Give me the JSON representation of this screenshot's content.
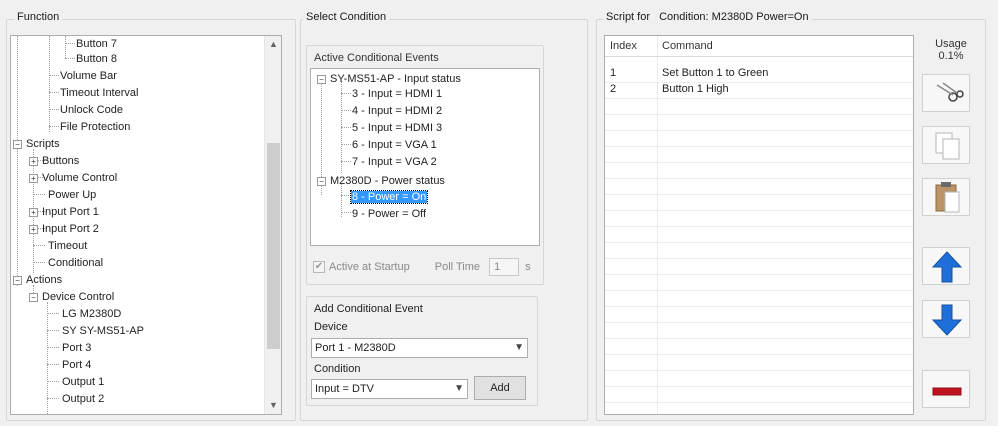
{
  "function_panel": {
    "title": "Function",
    "tree": [
      {
        "label": "Button 7"
      },
      {
        "label": "Button 8"
      },
      {
        "label": "Volume Bar"
      },
      {
        "label": "Timeout Interval"
      },
      {
        "label": "Unlock Code"
      },
      {
        "label": "File Protection"
      },
      {
        "label": "Scripts"
      },
      {
        "label": "Buttons"
      },
      {
        "label": "Volume Control"
      },
      {
        "label": "Power Up"
      },
      {
        "label": "Input Port 1"
      },
      {
        "label": "Input Port 2"
      },
      {
        "label": "Timeout"
      },
      {
        "label": "Conditional"
      },
      {
        "label": "Actions"
      },
      {
        "label": "Device Control"
      },
      {
        "label": "LG M2380D"
      },
      {
        "label": "SY SY-MS51-AP"
      },
      {
        "label": "Port 3"
      },
      {
        "label": "Port 4"
      },
      {
        "label": "Output 1"
      },
      {
        "label": "Output 2"
      }
    ],
    "expanders": {
      "expanded": "−",
      "collapsed": "+"
    }
  },
  "condition_panel": {
    "title": "Select Condition",
    "active_events": {
      "title": "Active Conditional Events",
      "tree": [
        {
          "label": "SY-MS51-AP - Input status"
        },
        {
          "label": "3 - Input = HDMI 1"
        },
        {
          "label": "4 - Input = HDMI 2"
        },
        {
          "label": "5 - Input = HDMI 3"
        },
        {
          "label": "6 - Input = VGA 1"
        },
        {
          "label": "7 - Input = VGA 2"
        },
        {
          "label": "M2380D - Power status"
        },
        {
          "label": "8 - Power = On"
        },
        {
          "label": "9 - Power = Off"
        }
      ]
    },
    "active_at_startup": {
      "label": "Active at Startup",
      "checked": true
    },
    "poll_time": {
      "label": "Poll Time",
      "value": "1",
      "unit": "s"
    },
    "add_event": {
      "title": "Add Conditional Event",
      "device_label": "Device",
      "device_value": "Port 1 - M2380D",
      "condition_label": "Condition",
      "condition_value": "Input = DTV",
      "add_button": "Add"
    }
  },
  "script_panel": {
    "title_prefix": "Script for",
    "title_condition": "Condition: M2380D Power=On",
    "columns": [
      "Index",
      "Command"
    ],
    "rows": [
      {
        "index": "1",
        "command": "Set Button 1 to Green"
      },
      {
        "index": "2",
        "command": "Button 1 High"
      }
    ],
    "usage_label": "Usage",
    "usage_value": "0.1%",
    "tools": [
      {
        "icon": "cut-icon"
      },
      {
        "icon": "copy-icon"
      },
      {
        "icon": "paste-icon"
      },
      {
        "icon": "move-up-icon",
        "color": "#1e6fd9"
      },
      {
        "icon": "move-down-icon",
        "color": "#1e6fd9"
      },
      {
        "icon": "delete-icon",
        "color": "#c1121f"
      }
    ]
  }
}
